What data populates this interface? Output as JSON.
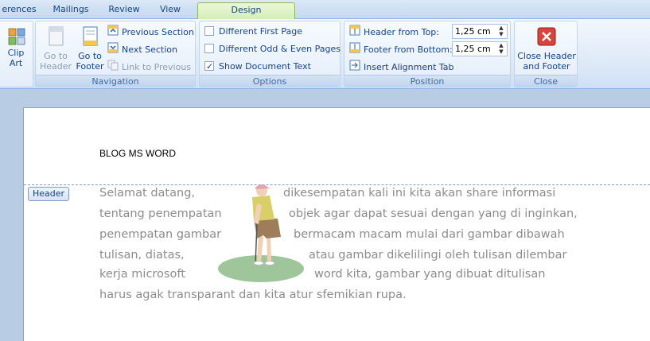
{
  "tabs": [
    "erences",
    "Mailings",
    "Review",
    "View",
    "Design"
  ],
  "active_tab": "Design",
  "groups": {
    "clipart": {
      "label1": "Clip",
      "label2": "Art"
    },
    "navigation": {
      "label": "Navigation",
      "goto_header": [
        "Go to",
        "Header"
      ],
      "goto_footer": [
        "Go to",
        "Footer"
      ],
      "previous_section": "Previous Section",
      "next_section": "Next Section",
      "link_previous": "Link to Previous"
    },
    "options": {
      "label": "Options",
      "different_first_page": {
        "text": "Different First Page",
        "checked": false
      },
      "different_odd_even": {
        "text": "Different Odd & Even Pages",
        "checked": false
      },
      "show_document_text": {
        "text": "Show Document Text",
        "checked": true
      }
    },
    "position": {
      "label": "Position",
      "header_from_top": {
        "label": "Header from Top:",
        "value": "1,25 cm"
      },
      "footer_from_bottom": {
        "label": "Footer from Bottom:",
        "value": "1,25 cm"
      },
      "insert_alignment_tab": "Insert Alignment Tab"
    },
    "close": {
      "label": "Close",
      "button": [
        "Close Header",
        "and Footer"
      ]
    }
  },
  "document": {
    "header_text": "BLOG MS WORD",
    "header_badge": "Header",
    "lines": [
      [
        "Selamat datang,",
        "dikesempatan kali ini kita akan share informasi"
      ],
      [
        "tentang penempatan",
        "objek agar dapat sesuai dengan yang di inginkan,"
      ],
      [
        "penempatan gambar",
        "bermacam macam mulai dari gambar dibawah"
      ],
      [
        "tulisan, diatas,",
        "atau gambar dikelilingi oleh tulisan dilembar"
      ],
      [
        "kerja microsoft",
        "word kita, gambar yang dibuat  ditulisan"
      ],
      [
        "harus agak transparant dan kita atur sfemikian rupa.",
        ""
      ]
    ]
  }
}
